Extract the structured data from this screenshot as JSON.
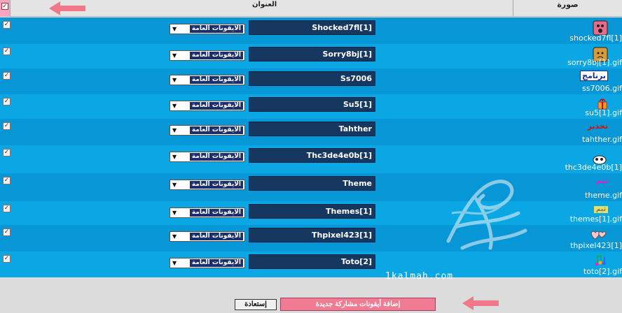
{
  "header": {
    "title_col": "العنوان",
    "image_col": "صورة",
    "select_all_checked": true
  },
  "rows": [
    {
      "title": "Shocked7fl[1]",
      "category": "الايقونات العامة",
      "file": "shocked7fl[1]",
      "icon": "shocked-face-icon",
      "checked": true
    },
    {
      "title": "Sorry8bj[1]",
      "category": "الايقونات العامة",
      "file": "sorry8bj[1].gif",
      "icon": "sorry-face-icon",
      "checked": true
    },
    {
      "title": "Ss7006",
      "category": "الايقونات العامة",
      "file": "ss7006.gif",
      "icon": "program-label-icon",
      "icon_text": "برنامج",
      "checked": true
    },
    {
      "title": "Su5[1]",
      "category": "الايقونات العامة",
      "file": "su5[1].gif",
      "icon": "gift-icon",
      "checked": true
    },
    {
      "title": "Tahther",
      "category": "الايقونات العامة",
      "file": "tahther.gif",
      "icon": "warning-text-icon",
      "icon_text": "تحذير",
      "checked": true
    },
    {
      "title": "Thc3de4e0b[1]",
      "category": "الايقونات العامة",
      "file": "thc3de4e0b[1]",
      "icon": "cartoon-bee-icon",
      "checked": true
    },
    {
      "title": "Theme",
      "category": "الايقونات العامة",
      "file": "theme.gif",
      "icon": "theme-text-icon",
      "icon_text": "ثيم",
      "checked": true
    },
    {
      "title": "Themes[1]",
      "category": "الايقونات العامة",
      "file": "themes[1].gif",
      "icon": "themes-badge-icon",
      "icon_text": "ثيم",
      "checked": true
    },
    {
      "title": "Thpixel423[1]",
      "category": "الايقونات العامة",
      "file": "thpixel423[1]",
      "icon": "hearts-icon",
      "checked": true
    },
    {
      "title": "Toto[2]",
      "category": "الايقونات العامة",
      "file": "toto[2].gif",
      "icon": "music-notes-icon",
      "checked": true
    }
  ],
  "watermark": "1kalmah.com",
  "footer": {
    "restore_label": "إستعادة",
    "add_label": "إضافة أيقونات مشاركة جديدة"
  },
  "colors": {
    "row_odd": "#0897d6",
    "row_even": "#0aa7e4",
    "title_field": "#16375f",
    "accent_arrow": "#f07888",
    "add_button": "#f07b93"
  }
}
